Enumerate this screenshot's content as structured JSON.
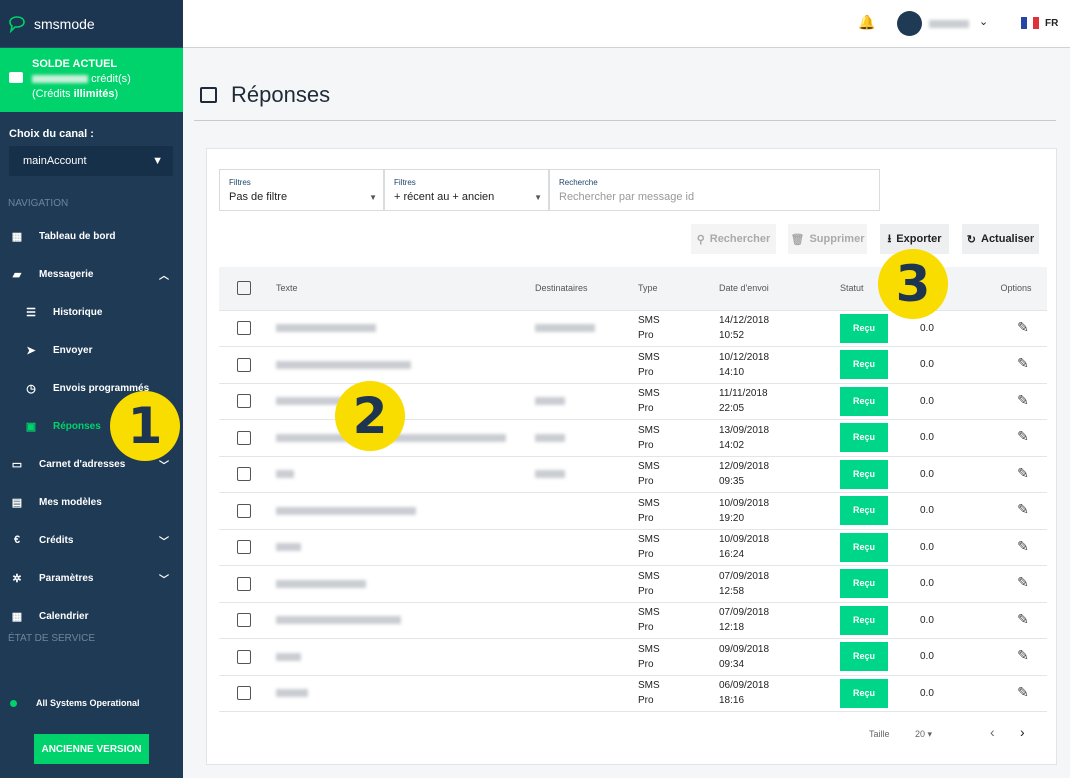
{
  "app": {
    "name": "smsmode"
  },
  "balance": {
    "title": "SOLDE ACTUEL",
    "unit": "crédit(s)",
    "note_prefix": "(Crédits ",
    "note_bold": "illimités",
    "note_suffix": ")"
  },
  "channel": {
    "label": "Choix du canal :",
    "value": "mainAccount"
  },
  "nav": {
    "section": "NAVIGATION",
    "items": [
      {
        "label": "Tableau de bord",
        "icon": "dashboard-icon"
      },
      {
        "label": "Messagerie",
        "icon": "chat-icon",
        "chevron": "up"
      },
      {
        "label": "Historique",
        "icon": "list-icon"
      },
      {
        "label": "Envoyer",
        "icon": "send-icon"
      },
      {
        "label": "Envois programmés",
        "icon": "clock-icon"
      },
      {
        "label": "Réponses",
        "icon": "inbox-icon",
        "active": true
      },
      {
        "label": "Carnet d'adresses",
        "icon": "book-icon",
        "chevron": "down"
      },
      {
        "label": "Mes modèles",
        "icon": "template-icon"
      },
      {
        "label": "Crédits",
        "icon": "euro-icon",
        "chevron": "down"
      },
      {
        "label": "Paramètres",
        "icon": "gear-icon",
        "chevron": "down"
      },
      {
        "label": "Calendrier",
        "icon": "calendar-icon"
      }
    ]
  },
  "service": {
    "section": "ÉTAT DE SERVICE",
    "status": "All Systems Operational",
    "color": "#00d36b"
  },
  "old_version": "ANCIENNE VERSION",
  "topbar": {
    "lang": "FR"
  },
  "page": {
    "title": "Réponses"
  },
  "filters": [
    {
      "label": "Filtres",
      "value": "Pas de filtre"
    },
    {
      "label": "Filtres",
      "value": "+ récent au + ancien"
    }
  ],
  "search": {
    "label": "Recherche",
    "placeholder": "Rechercher par message id"
  },
  "actions": {
    "search": "Rechercher",
    "delete": "Supprimer",
    "export": "Exporter",
    "refresh": "Actualiser"
  },
  "table": {
    "headers": {
      "text": "Texte",
      "recipients": "Destinataires",
      "type": "Type",
      "date": "Date d'envoi",
      "status": "Statut",
      "options": "Options"
    },
    "rows": [
      {
        "type1": "SMS",
        "type2": "Pro",
        "date": "14/12/2018",
        "time": "10:52",
        "status": "Reçu",
        "price": "0.0"
      },
      {
        "type1": "SMS",
        "type2": "Pro",
        "date": "10/12/2018",
        "time": "14:10",
        "status": "Reçu",
        "price": "0.0"
      },
      {
        "type1": "SMS",
        "type2": "Pro",
        "date": "11/11/2018",
        "time": "22:05",
        "status": "Reçu",
        "price": "0.0"
      },
      {
        "type1": "SMS",
        "type2": "Pro",
        "date": "13/09/2018",
        "time": "14:02",
        "status": "Reçu",
        "price": "0.0"
      },
      {
        "type1": "SMS",
        "type2": "Pro",
        "date": "12/09/2018",
        "time": "09:35",
        "status": "Reçu",
        "price": "0.0"
      },
      {
        "type1": "SMS",
        "type2": "Pro",
        "date": "10/09/2018",
        "time": "19:20",
        "status": "Reçu",
        "price": "0.0"
      },
      {
        "type1": "SMS",
        "type2": "Pro",
        "date": "10/09/2018",
        "time": "16:24",
        "status": "Reçu",
        "price": "0.0"
      },
      {
        "type1": "SMS",
        "type2": "Pro",
        "date": "07/09/2018",
        "time": "12:58",
        "status": "Reçu",
        "price": "0.0"
      },
      {
        "type1": "SMS",
        "type2": "Pro",
        "date": "07/09/2018",
        "time": "12:18",
        "status": "Reçu",
        "price": "0.0"
      },
      {
        "type1": "SMS",
        "type2": "Pro",
        "date": "09/09/2018",
        "time": "09:34",
        "status": "Reçu",
        "price": "0.0"
      },
      {
        "type1": "SMS",
        "type2": "Pro",
        "date": "06/09/2018",
        "time": "18:16",
        "status": "Reçu",
        "price": "0.0"
      }
    ]
  },
  "pagination": {
    "size_label": "Taille",
    "size": "20"
  },
  "callouts": [
    "1",
    "2",
    "3"
  ],
  "colors": {
    "sidebar": "#1f3a55",
    "accent": "#00d36b",
    "badge": "#00d68a",
    "callout": "#f9dc00"
  }
}
